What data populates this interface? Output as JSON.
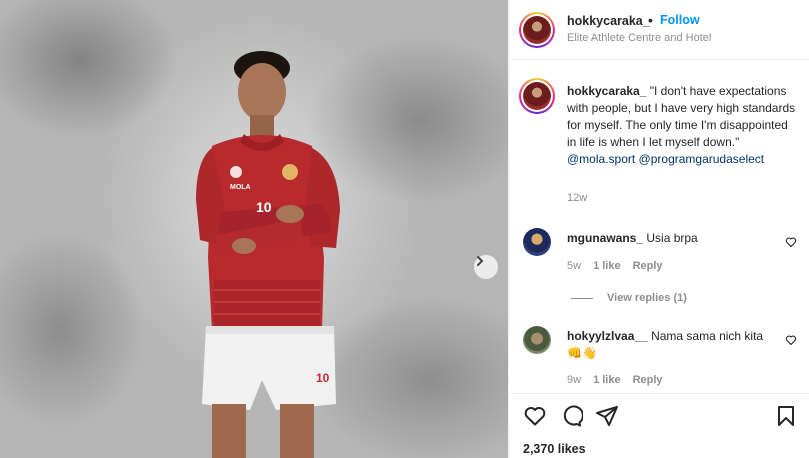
{
  "post": {
    "username": "hokkycaraka_",
    "follow_label": "Follow",
    "location": "Elite Athlete Centre and Hotel",
    "jersey_number": "10",
    "shorts_number": "10",
    "jersey_brand": "MOLA"
  },
  "caption": {
    "username": "hokkycaraka_",
    "text": "\"I don't have expectations with people, but I have very high standards for myself. The only time I'm disappointed in life is when I let myself down.\"",
    "mention_1": "@mola.sport",
    "mention_2": "@programgarudaselect",
    "time": "12w"
  },
  "comments": [
    {
      "username": "mgunawans_",
      "text": "Usia brpa",
      "time": "5w",
      "likes": "1 like",
      "reply_label": "Reply",
      "view_replies": "View replies (1)"
    },
    {
      "username": "hokyylzlvaa__",
      "text": "Nama sama nich kita 👊👋",
      "time": "9w",
      "likes": "1 like",
      "reply_label": "Reply"
    }
  ],
  "footer": {
    "likes": "2,370 likes"
  },
  "colors": {
    "jersey_red": "#b82a2e",
    "link_blue": "#0095f6",
    "mention_blue": "#00376b",
    "muted": "#8e8e8e"
  },
  "icons": [
    "chevron-right-icon",
    "heart-icon",
    "comment-icon",
    "share-icon",
    "bookmark-icon"
  ]
}
